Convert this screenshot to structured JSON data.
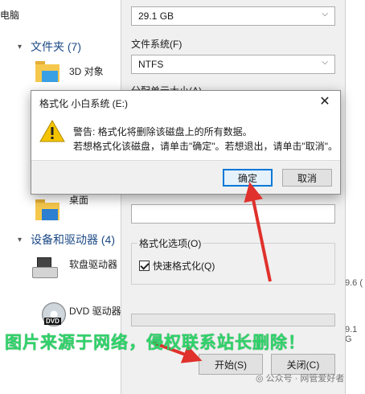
{
  "explorer": {
    "top_label": "电脑",
    "sections": {
      "folders": "文件夹 (7)",
      "devices": "设备和驱动器 (4)"
    },
    "items": {
      "objects3d": "3D 对象",
      "desktop": "桌面",
      "floppy": "软盘驱动器",
      "dvd": "DVD 驱动器",
      "dvd_icon_text": "DVD"
    },
    "side_values": [
      "9.6 (",
      "9.1 G"
    ]
  },
  "format_panel": {
    "capacity_value": "29.1 GB",
    "filesystem_label": "文件系统(F)",
    "filesystem_value": "NTFS",
    "allocation_label_partial": "分配单元大小(A)",
    "format_options_label": "格式化选项(O)",
    "quick_format_label": "快速格式化(Q)",
    "quick_format_checked": true,
    "start_button": "开始(S)",
    "close_button": "关闭(C)"
  },
  "dialog": {
    "title": "格式化 小白系统 (E:)",
    "close_glyph": "✕",
    "message_line1": "警告: 格式化将删除该磁盘上的所有数据。",
    "message_line2": "若想格式化该磁盘，请单击\"确定\"。若想退出，请单击\"取消\"。",
    "ok_button": "确定",
    "cancel_button": "取消",
    "icon": "warning-icon"
  },
  "overlay": {
    "watermark": "图片来源于网络，侵权联系站长删除！",
    "source_tag": "公众号 · 网管爱好者"
  },
  "colors": {
    "accent": "#0078d7",
    "arrow": "#e0312c",
    "watermark": "#2fd36a",
    "warning": "#f5c400"
  }
}
